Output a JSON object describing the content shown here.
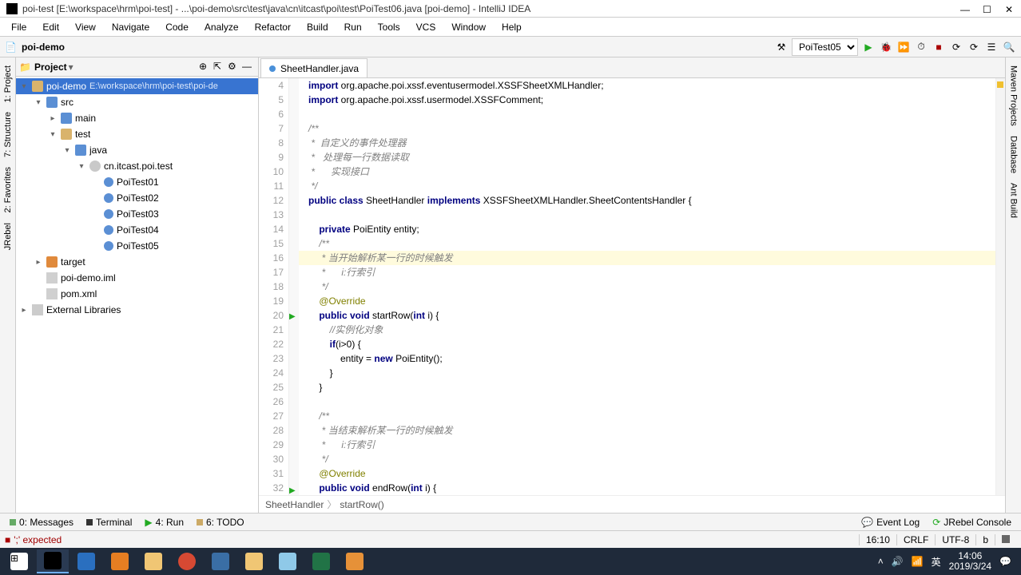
{
  "window": {
    "title": "poi-test [E:\\workspace\\hrm\\poi-test] - ...\\poi-demo\\src\\test\\java\\cn\\itcast\\poi\\test\\PoiTest06.java [poi-demo] - IntelliJ IDEA"
  },
  "menu": [
    "File",
    "Edit",
    "View",
    "Navigate",
    "Code",
    "Analyze",
    "Refactor",
    "Build",
    "Run",
    "Tools",
    "VCS",
    "Window",
    "Help"
  ],
  "nav": {
    "breadcrumb": "poi-demo",
    "run_config": "PoiTest05"
  },
  "project_header": "Project",
  "tree": {
    "root": {
      "label": "poi-demo",
      "path": "E:\\workspace\\hrm\\poi-test\\poi-de"
    },
    "nodes": [
      {
        "indent": 1,
        "label": "src",
        "expanded": true,
        "icon": "folder-src"
      },
      {
        "indent": 2,
        "label": "main",
        "expanded": false,
        "icon": "folder-src"
      },
      {
        "indent": 2,
        "label": "test",
        "expanded": true,
        "icon": "folder-icon"
      },
      {
        "indent": 3,
        "label": "java",
        "expanded": true,
        "icon": "folder-src"
      },
      {
        "indent": 4,
        "label": "cn.itcast.poi.test",
        "expanded": true,
        "icon": "pkg-icon"
      },
      {
        "indent": 5,
        "label": "PoiTest01",
        "icon": "class-icon"
      },
      {
        "indent": 5,
        "label": "PoiTest02",
        "icon": "class-icon"
      },
      {
        "indent": 5,
        "label": "PoiTest03",
        "icon": "class-icon"
      },
      {
        "indent": 5,
        "label": "PoiTest04",
        "icon": "class-icon"
      },
      {
        "indent": 5,
        "label": "PoiTest05",
        "icon": "class-icon"
      },
      {
        "indent": 1,
        "label": "target",
        "expanded": false,
        "icon": "target-icon"
      },
      {
        "indent": 1,
        "label": "poi-demo.iml",
        "icon": "file-icon"
      },
      {
        "indent": 1,
        "label": "pom.xml",
        "icon": "file-icon"
      }
    ],
    "ext_lib": "External Libraries"
  },
  "tab": {
    "label": "SheetHandler.java"
  },
  "code": {
    "first_line": 4,
    "lines": [
      {
        "html": "<span class='kw'>import</span> org.apache.poi.xssf.eventusermodel.XSSFSheetXMLHandler;"
      },
      {
        "html": "<span class='kw'>import</span> org.apache.poi.xssf.usermodel.XSSFComment;"
      },
      {
        "html": ""
      },
      {
        "html": "<span class='cm'>/**</span>"
      },
      {
        "html": "<span class='cm'> *  自定义的事件处理器</span>"
      },
      {
        "html": "<span class='cm'> *   处理每一行数据读取</span>"
      },
      {
        "html": "<span class='cm'> *      实现接口</span>"
      },
      {
        "html": "<span class='cm'> */</span>"
      },
      {
        "html": "<span class='kw'>public class</span> <span class='cls'>SheetHandler</span> <span class='kw'>implements</span> XSSFSheetXMLHandler.SheetContentsHandler {"
      },
      {
        "html": ""
      },
      {
        "html": "    <span class='kw'>private</span> <span class='cls'>PoiEntity</span> entity;"
      },
      {
        "html": "    <span class='cm'>/**</span>"
      },
      {
        "html": "    <span class='cm'> * 当开始解析某一行的时候触发</span>",
        "current": true
      },
      {
        "html": "    <span class='cm'> *      i:行索引</span>"
      },
      {
        "html": "    <span class='cm'> */</span>"
      },
      {
        "html": "    <span class='ann'>@Override</span>"
      },
      {
        "html": "    <span class='kw'>public void</span> <span class='cls'>startRow</span>(<span class='kw'>int</span> i) {",
        "marker": "▶"
      },
      {
        "html": "        <span class='cm'>//实例化对象</span>"
      },
      {
        "html": "        <span class='kw'>if</span>(i>0) {"
      },
      {
        "html": "            entity = <span class='kw'>new</span> <span class='cls'>PoiEntity</span>();"
      },
      {
        "html": "        }"
      },
      {
        "html": "    }"
      },
      {
        "html": ""
      },
      {
        "html": "    <span class='cm'>/**</span>"
      },
      {
        "html": "    <span class='cm'> * 当结束解析某一行的时候触发</span>"
      },
      {
        "html": "    <span class='cm'> *      i:行索引</span>"
      },
      {
        "html": "    <span class='cm'> */</span>"
      },
      {
        "html": "    <span class='ann'>@Override</span>"
      },
      {
        "html": "    <span class='kw'>public void</span> <span class='cls'>endRow</span>(<span class='kw'>int</span> i) {",
        "marker": "▶"
      }
    ]
  },
  "breadcrumb_editor": {
    "a": "SheetHandler",
    "b": "startRow()"
  },
  "bottom": {
    "messages": "0: Messages",
    "terminal": "Terminal",
    "run": "4: Run",
    "todo": "6: TODO",
    "eventlog": "Event Log",
    "jrebel": "JRebel Console"
  },
  "status": {
    "message": "';' expected",
    "pos": "16:10",
    "lineend": "CRLF",
    "encoding": "UTF-8",
    "vcs": "b"
  },
  "left_rail": [
    "1: Project",
    "7: Structure",
    "2: Favorites",
    "JRebel"
  ],
  "right_rail": [
    "Maven Projects",
    "Database",
    "Ant Build"
  ],
  "taskbar": {
    "time": "14:06",
    "date": "2019/3/24",
    "ime": "英"
  }
}
